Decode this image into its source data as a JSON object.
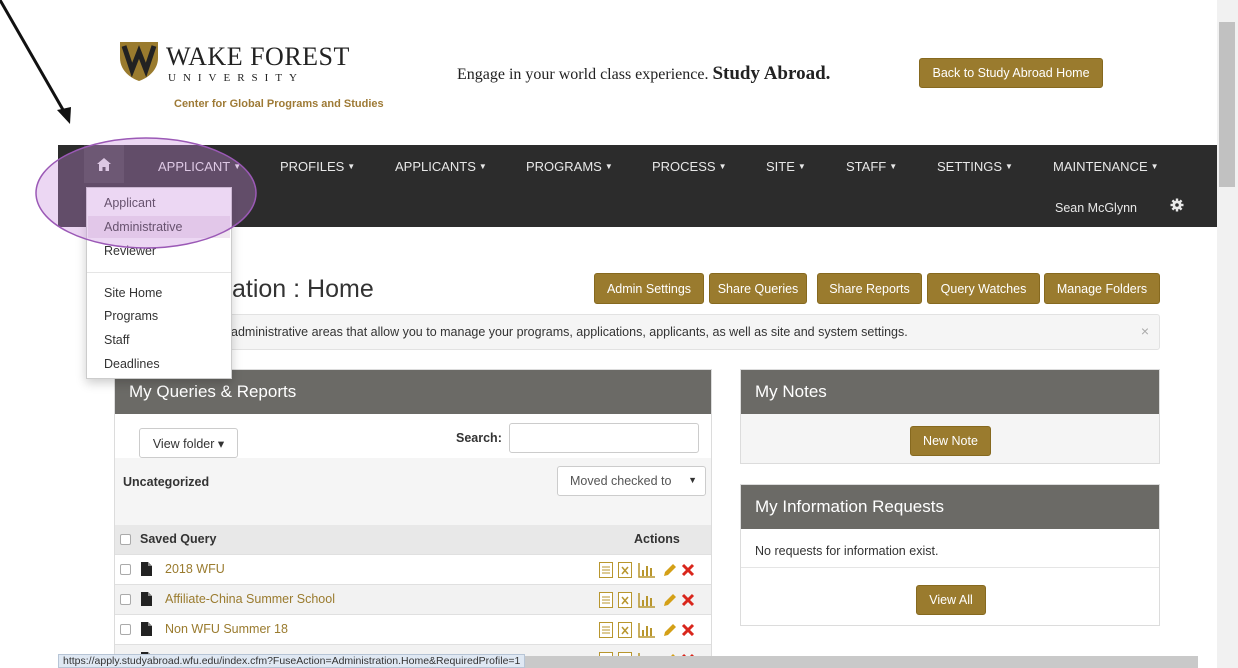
{
  "header": {
    "logo_name": "WAKE FOREST",
    "logo_university": "UNIVERSITY",
    "logo_center": "Center for Global Programs and Studies",
    "tagline_prefix": "Engage in your world class experience.",
    "tagline_bold": "Study Abroad.",
    "back_button": "Back to Study Abroad Home"
  },
  "navbar": {
    "home_icon": "home-icon",
    "items": [
      {
        "label": "APPLICANT"
      },
      {
        "label": "PROFILES"
      },
      {
        "label": "APPLICANTS"
      },
      {
        "label": "PROGRAMS"
      },
      {
        "label": "PROCESS"
      },
      {
        "label": "SITE"
      },
      {
        "label": "STAFF"
      },
      {
        "label": "SETTINGS"
      },
      {
        "label": "MAINTENANCE"
      }
    ],
    "user_name": "Sean McGlynn",
    "gear_icon": "gear-icon"
  },
  "dropdown": {
    "items": [
      "Applicant",
      "Administrative",
      "Reviewer",
      "Site Home",
      "Programs",
      "Staff",
      "Deadlines"
    ]
  },
  "page": {
    "title": "ation : Home",
    "buttons": [
      "Admin Settings",
      "Share Queries",
      "Share Reports",
      "Query Watches",
      "Manage Folders"
    ],
    "info_text": "administrative areas that allow you to manage your programs, applications, applicants, as well as site and system settings.",
    "info_close": "×"
  },
  "queries": {
    "heading": "My Queries & Reports",
    "view_folder": "View folder ▾",
    "search_label": "Search:",
    "search_value": "",
    "folder_name": "Uncategorized",
    "move_select": "Moved checked to",
    "col_name": "Saved Query",
    "col_actions": "Actions",
    "rows": [
      {
        "name": "2018 WFU"
      },
      {
        "name": "Affiliate-China Summer School"
      },
      {
        "name": "Non WFU Summer 18"
      }
    ]
  },
  "notes": {
    "heading": "My Notes",
    "new_note": "New Note"
  },
  "info_requests": {
    "heading": "My Information Requests",
    "empty": "No requests for information exist.",
    "view_all": "View All"
  },
  "status_bar": {
    "url": "https://apply.studyabroad.wfu.edu/index.cfm?FuseAction=Administration.Home&RequiredProfile=1"
  },
  "colors": {
    "gold": "#9a7b2e",
    "navbar": "#2c2c2c",
    "panel_header": "#6b6a66",
    "annotation": "#9b59b6"
  }
}
